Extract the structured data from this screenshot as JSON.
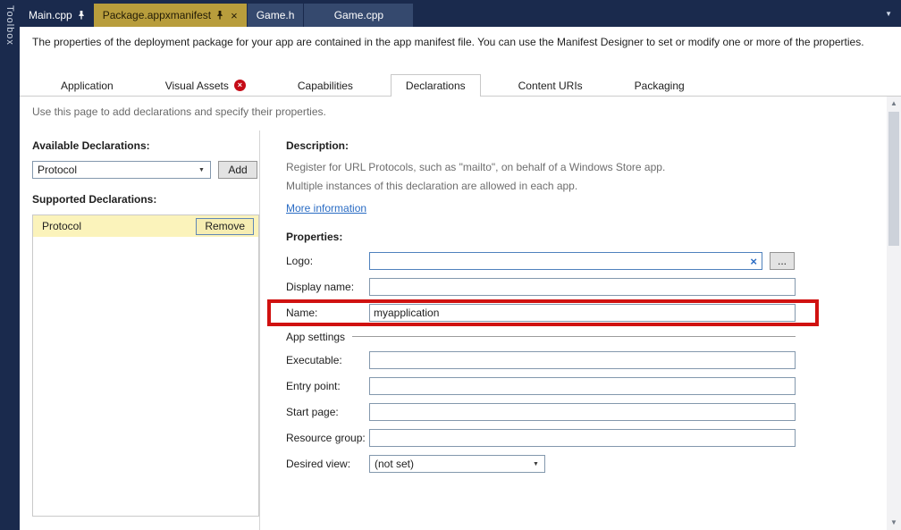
{
  "colors": {
    "titlebar_blue": "#1a2a4d",
    "active_tab_gold": "#b89d3c",
    "inactive_tab_blue": "#35496e",
    "annotation_red": "#d01110",
    "link_blue": "#2a6cc4",
    "error_red": "#c50b17",
    "selection_yellow": "#fbf3bb"
  },
  "icons": {
    "pin": "pushpin",
    "close": "×",
    "error_cross": "×",
    "dropdown_arrow": "▼",
    "clear": "×",
    "scroll_up": "▲",
    "scroll_down": "▼",
    "tab_overflow": "▼"
  },
  "toolbox": {
    "label": "Toolbox"
  },
  "editor_tabs": {
    "items": [
      {
        "label": "Main.cpp"
      },
      {
        "label": "Package.appxmanifest"
      },
      {
        "label": "Game.h"
      },
      {
        "label": "Game.cpp"
      }
    ]
  },
  "manifest": {
    "intro": "The properties of the deployment package for your app are contained in the app manifest file. You can use the Manifest Designer to set or modify one or more of the properties.",
    "tabs": [
      {
        "label": "Application"
      },
      {
        "label": "Visual Assets"
      },
      {
        "label": "Capabilities"
      },
      {
        "label": "Declarations"
      },
      {
        "label": "Content URIs"
      },
      {
        "label": "Packaging"
      }
    ],
    "page_hint": "Use this page to add declarations and specify their properties."
  },
  "declarations": {
    "available_label": "Available Declarations:",
    "available_value": "Protocol",
    "add_button": "Add",
    "supported_label": "Supported Declarations:",
    "supported_items": [
      {
        "label": "Protocol",
        "remove_button": "Remove"
      }
    ]
  },
  "details": {
    "description_heading": "Description:",
    "description_line1": "Register for URL Protocols, such as \"mailto\", on behalf of a Windows Store app.",
    "description_line2": "Multiple instances of this declaration are allowed in each app.",
    "more_info": "More information",
    "properties_heading": "Properties:",
    "logo_label": "Logo:",
    "logo_value": "",
    "browse_button": "...",
    "display_name_label": "Display name:",
    "display_name_value": "",
    "name_label": "Name:",
    "name_value": "myapplication",
    "app_settings_label": "App settings",
    "executable_label": "Executable:",
    "executable_value": "",
    "entry_point_label": "Entry point:",
    "entry_point_value": "",
    "start_page_label": "Start page:",
    "start_page_value": "",
    "resource_group_label": "Resource group:",
    "resource_group_value": "",
    "desired_view_label": "Desired view:",
    "desired_view_value": "(not set)"
  }
}
